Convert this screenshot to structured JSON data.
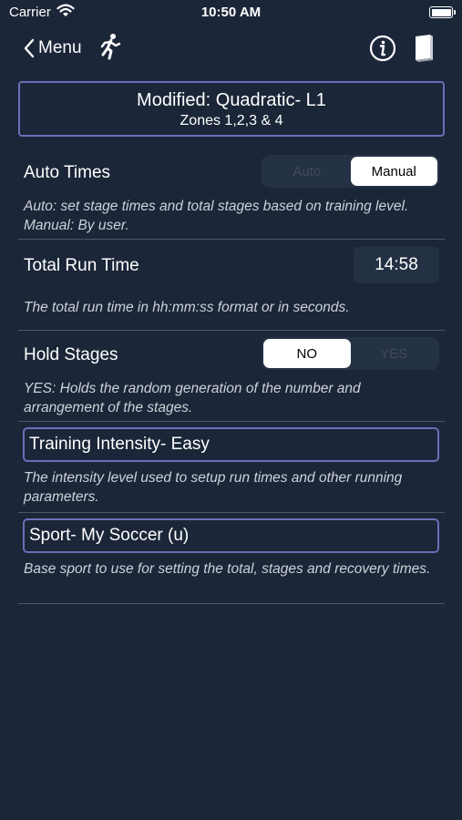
{
  "status_bar": {
    "carrier": "Carrier",
    "time": "10:50 AM"
  },
  "nav": {
    "back_label": "Menu"
  },
  "header": {
    "title": "Modified: Quadratic- L1",
    "subtitle": "Zones 1,2,3 & 4"
  },
  "auto_times": {
    "label": "Auto Times",
    "options": [
      "Auto",
      "Manual"
    ],
    "selected": "Manual",
    "description": "Auto: set stage times and total stages based on training level. Manual: By user."
  },
  "total_run_time": {
    "label": "Total Run Time",
    "value": "14:58",
    "description": "The total run time in hh:mm:ss format or in seconds."
  },
  "hold_stages": {
    "label": "Hold Stages",
    "options": [
      "NO",
      "YES"
    ],
    "selected": "NO",
    "description": "YES: Holds the random generation of the number and arrangement of the stages."
  },
  "training_intensity": {
    "value": "Training Intensity-  Easy",
    "description": "The intensity level used to setup run times and other running parameters."
  },
  "sport": {
    "value": "Sport- My Soccer (u)",
    "description": "Base sport to use for setting the total, stages and recovery times."
  },
  "colors": {
    "background": "#1b2638",
    "accent_border": "#6a6fb8",
    "divider": "#4e5666"
  },
  "icons": [
    "wifi-icon",
    "battery-icon",
    "chevron-left-icon",
    "runner-icon",
    "info-icon",
    "book-icon"
  ]
}
